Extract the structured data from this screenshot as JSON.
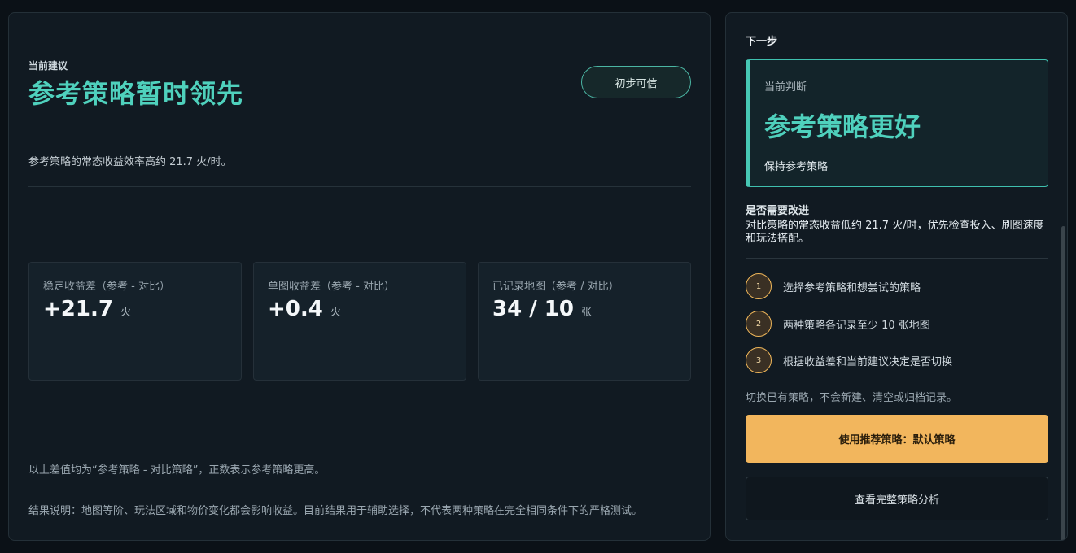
{
  "main": {
    "eyebrow": "当前建议",
    "headline": "参考策略暂时领先",
    "badge": "初步可信",
    "summary": "参考策略的常态收益效率高约 21.7 火/时。",
    "stats": [
      {
        "label": "稳定收益差（参考 - 对比）",
        "value": "+21.7",
        "unit": "火"
      },
      {
        "label": "单图收益差（参考 - 对比）",
        "value": "+0.4",
        "unit": "火"
      },
      {
        "label": "已记录地图（参考 / 对比）",
        "value": "34 / 10",
        "unit": "张"
      }
    ],
    "note_diff": "以上差值均为“参考策略 - 对比策略”，正数表示参考策略更高。",
    "note_result": "结果说明：地图等阶、玩法区域和物价变化都会影响收益。目前结果用于辅助选择，不代表两种策略在完全相同条件下的严格测试。"
  },
  "side": {
    "title": "下一步",
    "judgement_label": "当前判断",
    "judgement_value": "参考策略更好",
    "judgement_action": "保持参考策略",
    "improve_title": "是否需要改进",
    "improve_text": "对比策略的常态收益低约 21.7 火/时，优先检查投入、刷图速度和玩法搭配。",
    "steps": [
      {
        "num": "1",
        "text": "选择参考策略和想尝试的策略"
      },
      {
        "num": "2",
        "text": "两种策略各记录至少 10 张地图"
      },
      {
        "num": "3",
        "text": "根据收益差和当前建议决定是否切换"
      }
    ],
    "switch_note": "切换已有策略，不会新建、清空或归档记录。",
    "primary_button": "使用推荐策略：默认策略",
    "secondary_button": "查看完整策略分析"
  },
  "colors": {
    "accent": "#4fd1bd",
    "primary_button": "#f2b65d",
    "background": "#0b1117",
    "panel": "#111a22"
  }
}
